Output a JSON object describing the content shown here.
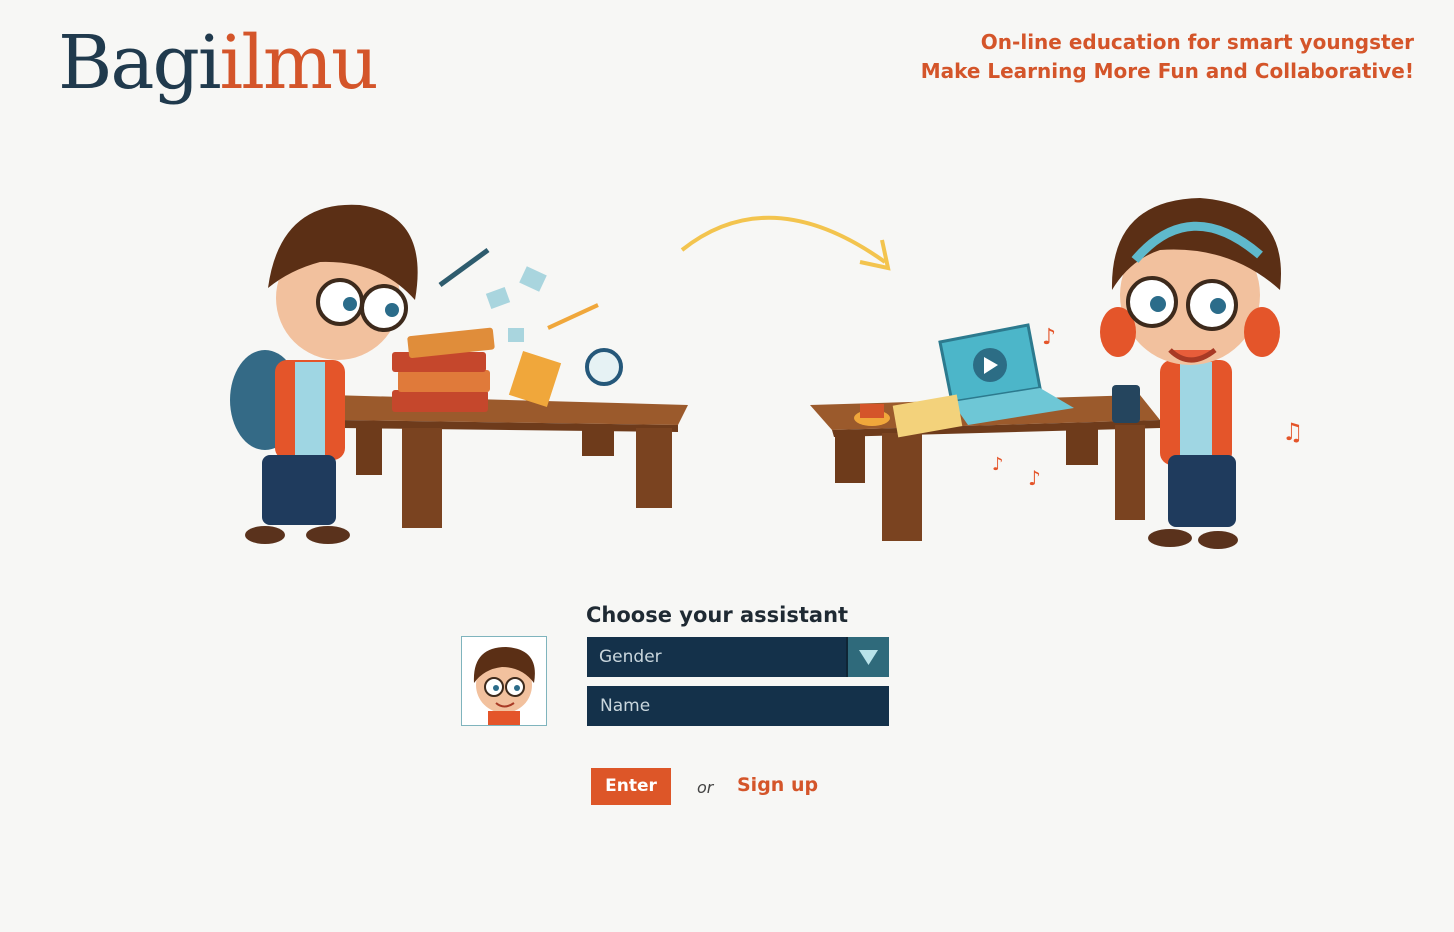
{
  "header": {
    "logo_part1": "Bagi",
    "logo_part2": "ilmu",
    "tagline_line1": "On-line education for smart youngster",
    "tagline_line2": "Make Learning More Fun and Collaborative!"
  },
  "illustration": {
    "left_scene": "boy-at-desk-with-books-icon",
    "arrow": "curved-arrow-icon",
    "right_scene": "boy-with-laptop-icon"
  },
  "form": {
    "title": "Choose your assistant",
    "gender_value": "Gender",
    "name_placeholder": "Name",
    "enter_label": "Enter",
    "or_label": "or",
    "signup_label": "Sign up"
  },
  "colors": {
    "brand_orange": "#d4552a",
    "brand_dark": "#203a4d",
    "input_bg": "#14314a",
    "button": "#dd5628"
  }
}
